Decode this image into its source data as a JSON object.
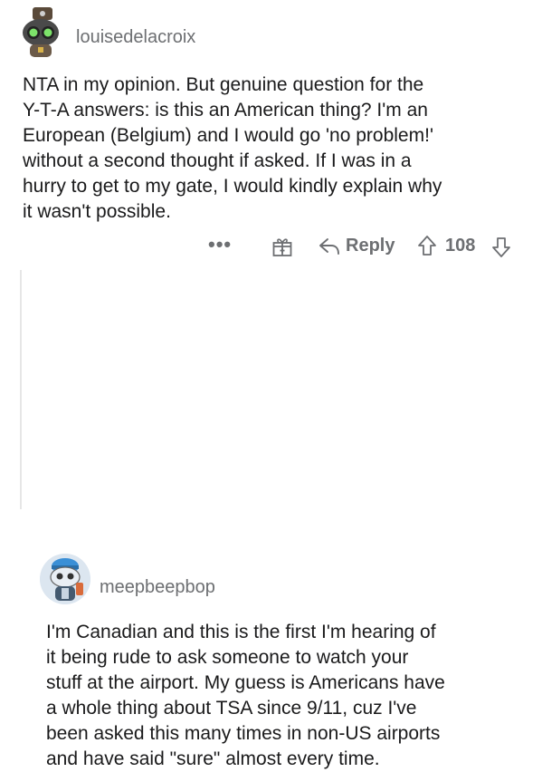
{
  "comments": [
    {
      "username": "louisedelacroix",
      "avatar": "louisedelacroix-snoo-avatar",
      "body": "NTA in my opinion. But genuine question for the\nY-T-A answers: is this an American thing? I'm an\nEuropean (Belgium) and I would go 'no problem!'\nwithout a second thought if asked. If I was in a\nhurry to get to my gate, I would kindly explain why\nit wasn't possible.",
      "actions": {
        "more": "•••",
        "reply_label": "Reply",
        "score": "108"
      }
    },
    {
      "username": "meepbeepbop",
      "avatar": "meepbeepbop-snoo-avatar",
      "body": "I'm Canadian and this is the first I'm hearing of\nit being rude to ask someone to watch your\nstuff at the airport. My guess is Americans have\na whole thing about TSA since 9/11, cuz I've\nbeen asked this many times in non-US airports\nand have said \"sure\" almost every time."
    }
  ],
  "colors": {
    "text": "#1a1a1b",
    "meta": "#6d6f72",
    "thread_line": "#e6e6e6"
  },
  "icons": [
    "more-icon",
    "gift-icon",
    "reply-icon",
    "upvote-icon",
    "downvote-icon"
  ]
}
